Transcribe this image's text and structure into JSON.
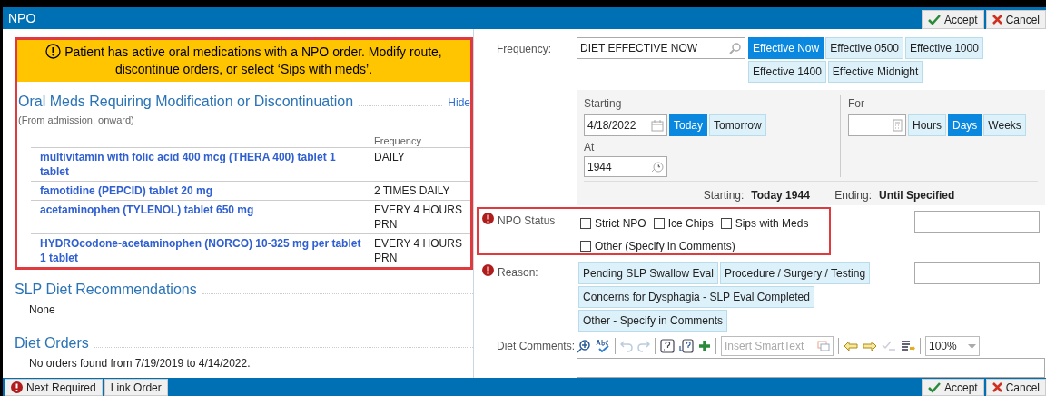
{
  "window": {
    "title": "NPO"
  },
  "header_buttons": [
    {
      "label": "Accept",
      "kind": "accept"
    },
    {
      "label": "Cancel",
      "kind": "cancel"
    }
  ],
  "alert": {
    "message": "Patient has active oral medications with a NPO order.  Modify route, discontinue orders, or select ‘Sips with meds’."
  },
  "oral_meds": {
    "title": "Oral Meds Requiring Modification or Discontinuation",
    "hide_link": "Hide",
    "subtitle": "(From admission, onward)",
    "frequency_header": "Frequency",
    "rows": [
      {
        "medication": "multivitamin with folic acid 400 mcg (THERA 400) tablet 1 tablet",
        "frequency": "DAILY"
      },
      {
        "medication": "famotidine (PEPCID) tablet 20 mg",
        "frequency": "2 TIMES DAILY"
      },
      {
        "medication": "acetaminophen (TYLENOL) tablet 650 mg",
        "frequency": "EVERY 4 HOURS PRN"
      },
      {
        "medication": "HYDROcodone-acetaminophen (NORCO) 10-325 mg per tablet 1 tablet",
        "frequency": "EVERY 4 HOURS PRN"
      }
    ]
  },
  "slp": {
    "title": "SLP Diet Recommendations",
    "text": "None"
  },
  "diet_orders": {
    "title": "Diet Orders",
    "text": "No orders found from 7/19/2019 to 4/14/2022."
  },
  "frequency": {
    "label": "Frequency:",
    "value": "DIET EFFECTIVE NOW",
    "options": [
      {
        "label": "Effective Now",
        "selected": true
      },
      {
        "label": "Effective 0500",
        "selected": false
      },
      {
        "label": "Effective 1000",
        "selected": false
      },
      {
        "label": "Effective 1400",
        "selected": false
      },
      {
        "label": "Effective Midnight",
        "selected": false
      }
    ]
  },
  "starting": {
    "label": "Starting",
    "date": "4/18/2022",
    "options": [
      {
        "label": "Today",
        "selected": true
      },
      {
        "label": "Tomorrow",
        "selected": false
      }
    ],
    "at_label": "At",
    "time": "1944"
  },
  "for": {
    "label": "For",
    "options": [
      {
        "label": "Hours",
        "selected": false
      },
      {
        "label": "Days",
        "selected": true
      },
      {
        "label": "Weeks",
        "selected": false
      }
    ]
  },
  "summary": {
    "starting_label": "Starting:",
    "starting_value": "Today 1944",
    "ending_label": "Ending:",
    "ending_value": "Until Specified"
  },
  "npo_status": {
    "label": "NPO Status",
    "required": true,
    "options": [
      {
        "label": "Strict NPO",
        "checked": false
      },
      {
        "label": "Ice Chips",
        "checked": false
      },
      {
        "label": "Sips with Meds",
        "checked": false
      },
      {
        "label": "Other (Specify in Comments)",
        "checked": false
      }
    ]
  },
  "reason": {
    "label": "Reason:",
    "required": true,
    "options": [
      {
        "label": "Pending SLP Swallow Eval",
        "selected": false
      },
      {
        "label": "Procedure / Surgery / Testing",
        "selected": false
      },
      {
        "label": "Concerns for Dysphagia - SLP Eval Completed",
        "selected": false
      },
      {
        "label": "Other - Specify in Comments",
        "selected": false
      }
    ]
  },
  "diet_comments": {
    "label": "Diet Comments:",
    "smarttext_placeholder": "Insert SmartText",
    "zoom": "100%"
  },
  "footer_left": [
    {
      "label": "Next Required",
      "kind": "next"
    },
    {
      "label": "Link Order",
      "kind": "link"
    }
  ],
  "footer_right": [
    {
      "label": "Accept",
      "kind": "accept"
    },
    {
      "label": "Cancel",
      "kind": "cancel"
    }
  ]
}
